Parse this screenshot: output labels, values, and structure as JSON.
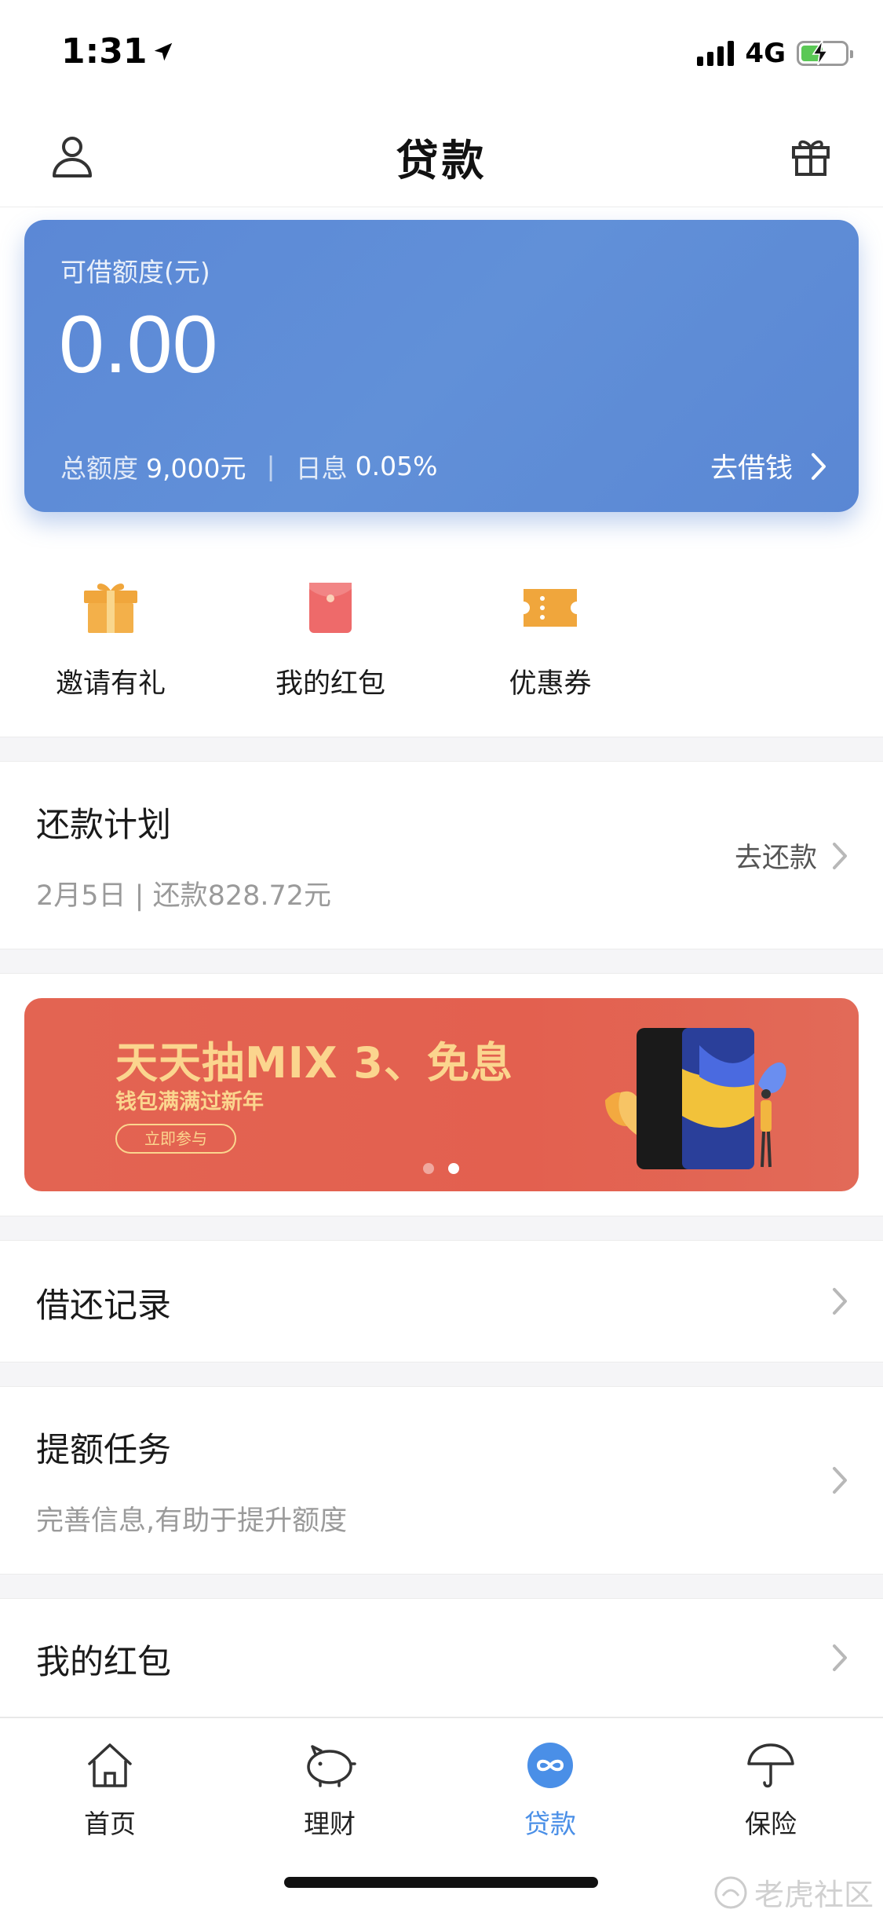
{
  "status_bar": {
    "time": "1:31",
    "network": "4G",
    "battery_percent": 50
  },
  "nav": {
    "title": "贷款"
  },
  "credit_card": {
    "label": "可借额度(元)",
    "amount": "0.00",
    "total_label": "总额度",
    "total_value": "9,000元",
    "separator": "|",
    "rate_label": "日息",
    "rate_value": "0.05%",
    "borrow_label": "去借钱"
  },
  "shortcuts": [
    {
      "label": "邀请有礼",
      "icon": "gift-box-icon"
    },
    {
      "label": "我的红包",
      "icon": "red-envelope-icon"
    },
    {
      "label": "优惠券",
      "icon": "coupon-icon"
    }
  ],
  "repayment_plan": {
    "title": "还款计划",
    "subtitle": "2月5日 | 还款828.72元",
    "action": "去还款"
  },
  "banner": {
    "title": "天天抽MIX 3、免息",
    "subtitle": "钱包满满过新年",
    "button": "立即参与",
    "slides_total": 2,
    "active_slide": 2
  },
  "rows": {
    "records": {
      "title": "借还记录"
    },
    "tasks": {
      "title": "提额任务",
      "subtitle": "完善信息,有助于提升额度"
    },
    "red_packets": {
      "title": "我的红包"
    }
  },
  "tabs": [
    {
      "label": "首页",
      "icon": "home-icon",
      "active": false
    },
    {
      "label": "理财",
      "icon": "piggy-bank-icon",
      "active": false
    },
    {
      "label": "贷款",
      "icon": "loan-icon",
      "active": true
    },
    {
      "label": "保险",
      "icon": "umbrella-icon",
      "active": false
    }
  ],
  "watermark": "老虎社区",
  "colors": {
    "accent": "#4a8fe7",
    "card": "#5b88d6",
    "banner": "#e3604f",
    "banner_text": "#fbd58e"
  }
}
